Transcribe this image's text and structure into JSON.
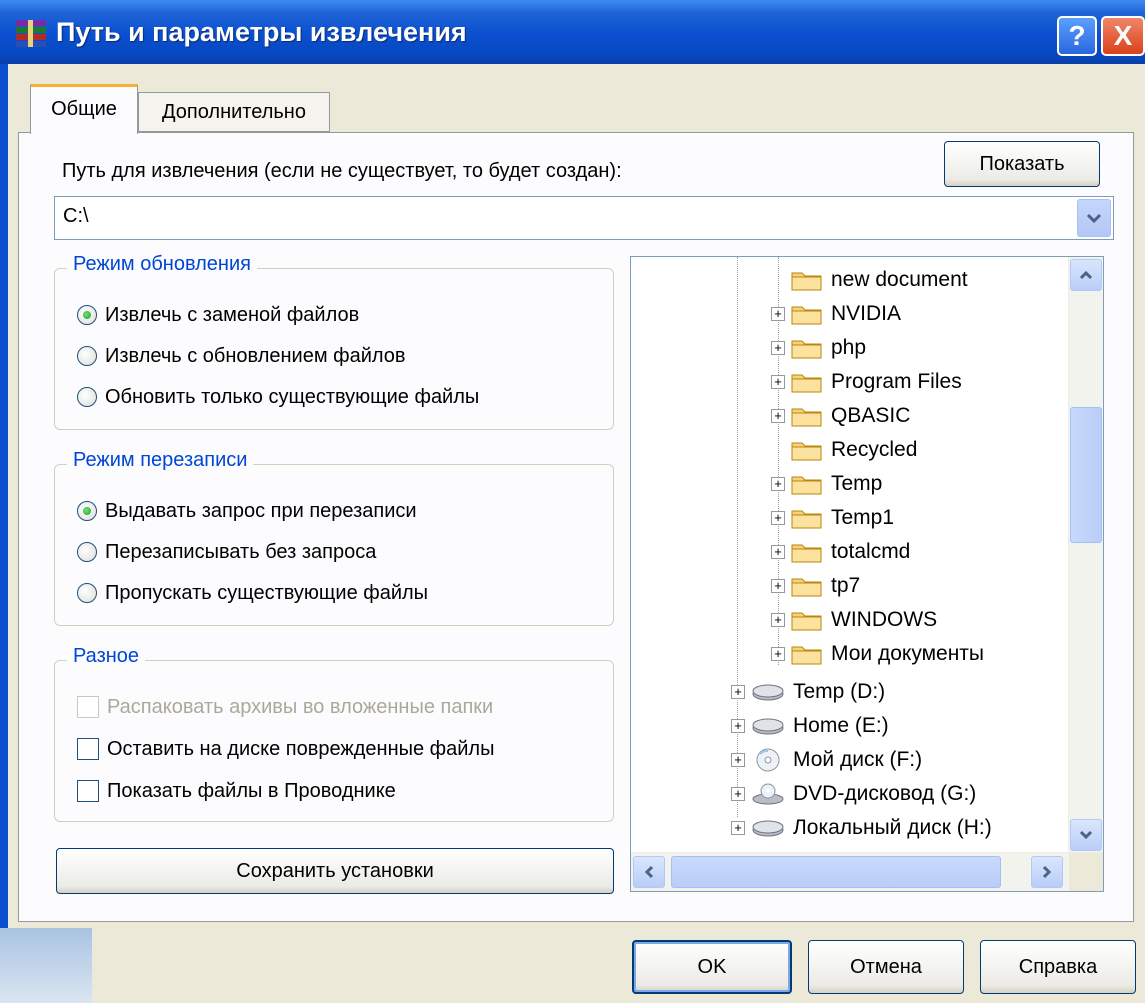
{
  "window": {
    "title": "Путь и параметры извлечения",
    "help_glyph": "?",
    "close_glyph": "X"
  },
  "tabs": [
    {
      "label": "Общие",
      "active": true
    },
    {
      "label": "Дополнительно",
      "active": false
    }
  ],
  "path": {
    "label": "Путь для извлечения (если не существует, то будет создан):",
    "value": "C:\\",
    "show_button": "Показать"
  },
  "update_mode": {
    "title": "Режим обновления",
    "options": [
      {
        "label": "Извлечь с заменой файлов",
        "checked": true
      },
      {
        "label": "Извлечь с обновлением файлов",
        "checked": false
      },
      {
        "label": "Обновить только существующие файлы",
        "checked": false
      }
    ]
  },
  "overwrite_mode": {
    "title": "Режим перезаписи",
    "options": [
      {
        "label": "Выдавать запрос при перезаписи",
        "checked": true
      },
      {
        "label": "Перезаписывать без запроса",
        "checked": false
      },
      {
        "label": "Пропускать существующие файлы",
        "checked": false
      }
    ]
  },
  "misc": {
    "title": "Разное",
    "options": [
      {
        "label": "Распаковать архивы во вложенные папки",
        "checked": false,
        "disabled": true
      },
      {
        "label": "Оставить на диске поврежденные файлы",
        "checked": false,
        "disabled": false
      },
      {
        "label": "Показать файлы в Проводнике",
        "checked": false,
        "disabled": false
      }
    ]
  },
  "save_button": "Сохранить установки",
  "tree": {
    "folders": [
      {
        "label": "new document",
        "expandable": false
      },
      {
        "label": "NVIDIA",
        "expandable": true
      },
      {
        "label": "php",
        "expandable": true
      },
      {
        "label": "Program Files",
        "expandable": true
      },
      {
        "label": "QBASIC",
        "expandable": true
      },
      {
        "label": "Recycled",
        "expandable": false
      },
      {
        "label": "Temp",
        "expandable": true
      },
      {
        "label": "Temp1",
        "expandable": true
      },
      {
        "label": "totalcmd",
        "expandable": true
      },
      {
        "label": "tp7",
        "expandable": true
      },
      {
        "label": "WINDOWS",
        "expandable": true
      },
      {
        "label": "Мои документы",
        "expandable": true
      }
    ],
    "drives": [
      {
        "label": "Temp (D:)",
        "icon": "hard-drive-icon"
      },
      {
        "label": "Home (E:)",
        "icon": "hard-drive-icon"
      },
      {
        "label": "Мой диск (F:)",
        "icon": "cd-disk-icon"
      },
      {
        "label": "DVD-дисковод (G:)",
        "icon": "dvd-drive-icon"
      },
      {
        "label": "Локальный диск (H:)",
        "icon": "hard-drive-icon"
      }
    ]
  },
  "buttons": {
    "ok": "OK",
    "cancel": "Отмена",
    "help": "Справка"
  },
  "colors": {
    "title_bar": "#0a4fd0",
    "group_title": "#0046d5",
    "active_tab_accent": "#f5b238",
    "radio_checked": "#21a121",
    "disabled_text": "#aca899"
  }
}
